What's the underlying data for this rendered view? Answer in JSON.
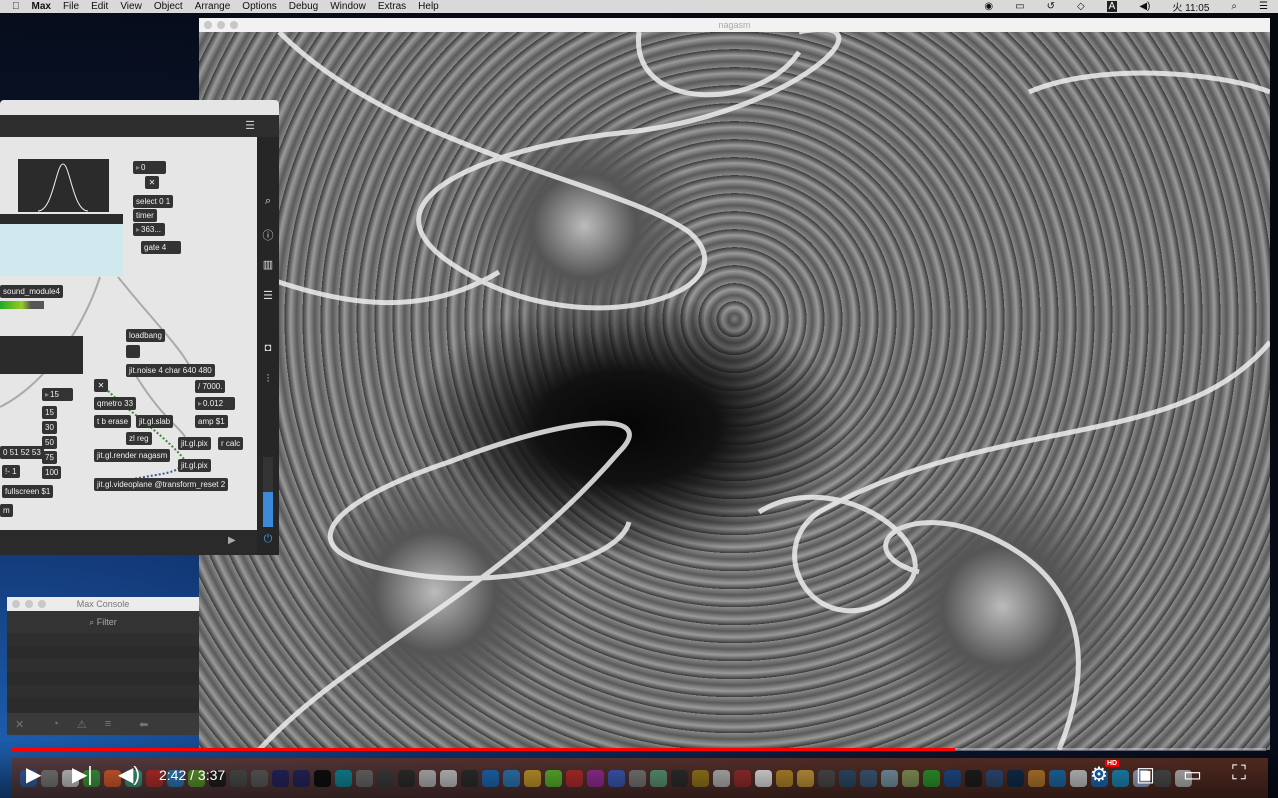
{
  "menubar": {
    "apple": "",
    "app": "Max",
    "items": [
      "File",
      "Edit",
      "View",
      "Object",
      "Arrange",
      "Options",
      "Debug",
      "Window",
      "Extras",
      "Help"
    ],
    "clock": "火 11:05",
    "input_badge": "A"
  },
  "render_window": {
    "title": "nagasm"
  },
  "patcher": {
    "objects": {
      "num0": "0",
      "select": "select 0 1",
      "timer": "timer",
      "num363": "363...",
      "gate": "gate 4",
      "sound": "sound_module4",
      "loadbang": "loadbang",
      "noise": "jit.noise 4 char 640 480",
      "div": "/ 7000.",
      "num012": "0.012",
      "qmetro": "qmetro 33",
      "tb": "t b erase",
      "slab": "jit.gl.slab",
      "amp": "amp $1",
      "zl": "zl reg",
      "pix1": "jit.gl.pix",
      "rcalc": "r calc",
      "render": "jit.gl.render nagasm",
      "pix2": "jit.gl.pix",
      "videoplane": "jit.gl.videoplane @transform_reset 2",
      "num15": "15",
      "m15": "15",
      "m30": "30",
      "m50": "50",
      "m75": "75",
      "m100": "100",
      "list": "0 51 52 53",
      "minus": "!- 1",
      "fullscreen": "fullscreen $1",
      "m": "m"
    }
  },
  "console": {
    "title": "Max Console",
    "filter_placeholder": "Filter"
  },
  "player": {
    "current_time": "2:42",
    "duration": "3:37",
    "time_display": "2:42 / 3:37",
    "progress": 0.752,
    "hd_badge": "HD",
    "accent": "#ff0000"
  }
}
